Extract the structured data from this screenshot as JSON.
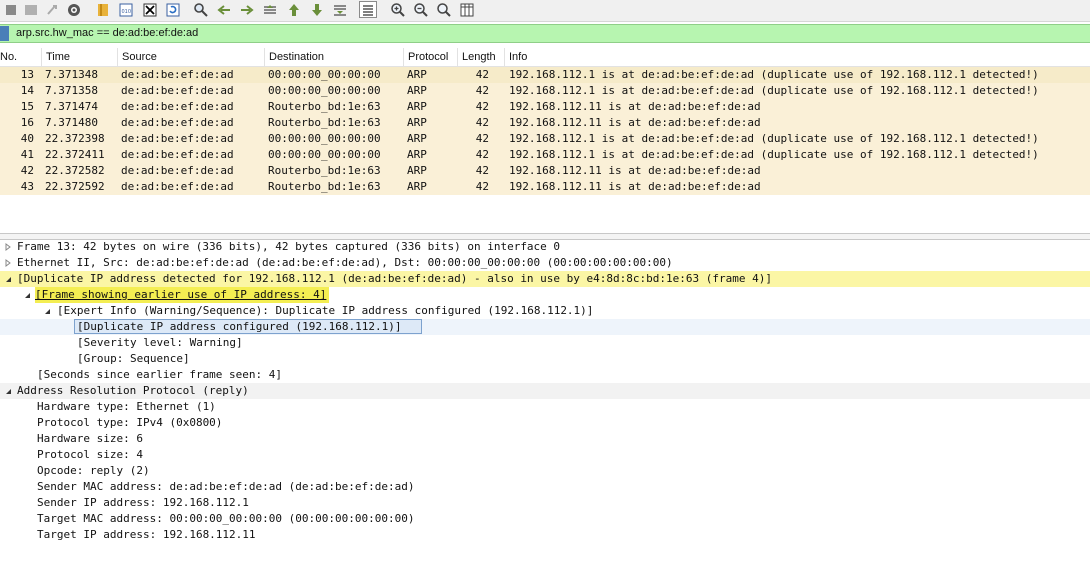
{
  "toolbar": {
    "icons": [
      "stop-capture-icon",
      "restart-capture-icon",
      "restart-alt-icon",
      "capture-options-icon",
      "open-file-icon",
      "save-file-icon",
      "close-file-icon",
      "reload-file-icon",
      "find-packet-icon",
      "go-back-icon",
      "go-forward-icon",
      "go-to-packet-icon",
      "first-packet-icon",
      "last-packet-icon",
      "autoscroll-icon",
      "colorize-icon",
      "zoom-in-icon",
      "zoom-out-icon",
      "normal-size-icon",
      "resize-columns-icon"
    ]
  },
  "filter": {
    "text": "arp.src.hw_mac == de:ad:be:ef:de:ad"
  },
  "packet_list": {
    "headers": {
      "no": "No.",
      "time": "Time",
      "source": "Source",
      "destination": "Destination",
      "protocol": "Protocol",
      "length": "Length",
      "info": "Info"
    },
    "rows": [
      {
        "no": "13",
        "time": "7.371348",
        "source": "de:ad:be:ef:de:ad",
        "destination": "00:00:00_00:00:00",
        "protocol": "ARP",
        "length": "42",
        "info": "192.168.112.1 is at de:ad:be:ef:de:ad (duplicate use of 192.168.112.1 detected!)"
      },
      {
        "no": "14",
        "time": "7.371358",
        "source": "de:ad:be:ef:de:ad",
        "destination": "00:00:00_00:00:00",
        "protocol": "ARP",
        "length": "42",
        "info": "192.168.112.1 is at de:ad:be:ef:de:ad (duplicate use of 192.168.112.1 detected!)"
      },
      {
        "no": "15",
        "time": "7.371474",
        "source": "de:ad:be:ef:de:ad",
        "destination": "Routerbo_bd:1e:63",
        "protocol": "ARP",
        "length": "42",
        "info": "192.168.112.11 is at de:ad:be:ef:de:ad"
      },
      {
        "no": "16",
        "time": "7.371480",
        "source": "de:ad:be:ef:de:ad",
        "destination": "Routerbo_bd:1e:63",
        "protocol": "ARP",
        "length": "42",
        "info": "192.168.112.11 is at de:ad:be:ef:de:ad"
      },
      {
        "no": "40",
        "time": "22.372398",
        "source": "de:ad:be:ef:de:ad",
        "destination": "00:00:00_00:00:00",
        "protocol": "ARP",
        "length": "42",
        "info": "192.168.112.1 is at de:ad:be:ef:de:ad (duplicate use of 192.168.112.1 detected!)"
      },
      {
        "no": "41",
        "time": "22.372411",
        "source": "de:ad:be:ef:de:ad",
        "destination": "00:00:00_00:00:00",
        "protocol": "ARP",
        "length": "42",
        "info": "192.168.112.1 is at de:ad:be:ef:de:ad (duplicate use of 192.168.112.1 detected!)"
      },
      {
        "no": "42",
        "time": "22.372582",
        "source": "de:ad:be:ef:de:ad",
        "destination": "Routerbo_bd:1e:63",
        "protocol": "ARP",
        "length": "42",
        "info": "192.168.112.11 is at de:ad:be:ef:de:ad"
      },
      {
        "no": "43",
        "time": "22.372592",
        "source": "de:ad:be:ef:de:ad",
        "destination": "Routerbo_bd:1e:63",
        "protocol": "ARP",
        "length": "42",
        "info": "192.168.112.11 is at de:ad:be:ef:de:ad"
      }
    ]
  },
  "details": {
    "lines": [
      {
        "text": "Frame 13: 42 bytes on wire (336 bits), 42 bytes captured (336 bits) on interface 0",
        "state": "collapsed"
      },
      {
        "text": "Ethernet II, Src: de:ad:be:ef:de:ad (de:ad:be:ef:de:ad), Dst: 00:00:00_00:00:00 (00:00:00:00:00:00)",
        "state": "collapsed"
      },
      {
        "text": "[Duplicate IP address detected for 192.168.112.1 (de:ad:be:ef:de:ad) - also in use by e4:8d:8c:bd:1e:63 (frame 4)]",
        "state": "expanded"
      },
      {
        "text": "[Frame showing earlier use of IP address: 4]",
        "state": "expanded"
      },
      {
        "text": "[Expert Info (Warning/Sequence): Duplicate IP address configured (192.168.112.1)]",
        "state": "expanded"
      },
      {
        "text": "[Duplicate IP address configured (192.168.112.1)]",
        "state": "leaf"
      },
      {
        "text": "[Severity level: Warning]",
        "state": "leaf"
      },
      {
        "text": "[Group: Sequence]",
        "state": "leaf"
      },
      {
        "text": "[Seconds since earlier frame seen: 4]",
        "state": "leaf"
      },
      {
        "text": "Address Resolution Protocol (reply)",
        "state": "expanded"
      },
      {
        "text": "Hardware type: Ethernet (1)",
        "state": "leaf"
      },
      {
        "text": "Protocol type: IPv4 (0x0800)",
        "state": "leaf"
      },
      {
        "text": "Hardware size: 6",
        "state": "leaf"
      },
      {
        "text": "Protocol size: 4",
        "state": "leaf"
      },
      {
        "text": "Opcode: reply (2)",
        "state": "leaf"
      },
      {
        "text": "Sender MAC address: de:ad:be:ef:de:ad (de:ad:be:ef:de:ad)",
        "state": "leaf"
      },
      {
        "text": "Sender IP address: 192.168.112.1",
        "state": "leaf"
      },
      {
        "text": "Target MAC address: 00:00:00_00:00:00 (00:00:00:00:00:00)",
        "state": "leaf"
      },
      {
        "text": "Target IP address: 192.168.112.11",
        "state": "leaf"
      }
    ]
  },
  "colors": {
    "row_bg": "#faf0d7",
    "filter_bg": "#b7f5b0",
    "warning_bg": "#fbf6a5",
    "warning_strong_bg": "#f4ee52",
    "selected_bg": "#dde9f7"
  }
}
